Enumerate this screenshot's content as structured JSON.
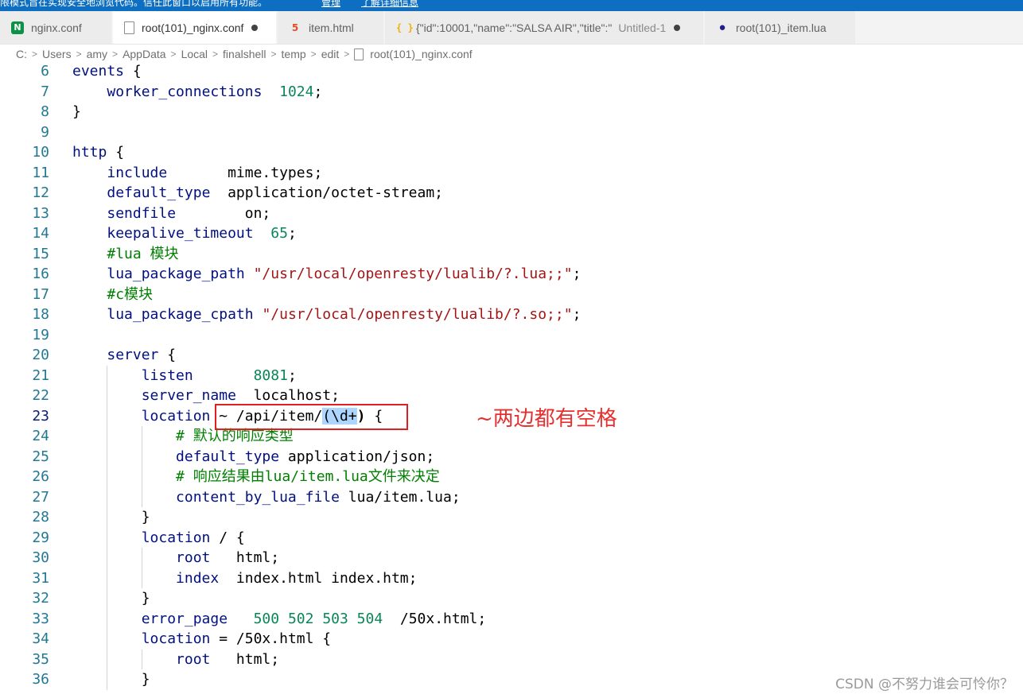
{
  "notice": {
    "message": "限模式旨在实现安全地浏览代码。信任此窗口以启用所有功能。",
    "manage_link": "管理",
    "learn_link": "了解详细信息"
  },
  "tabs": [
    {
      "label": "nginx.conf",
      "icon": "nginx-icon",
      "active": false,
      "modified": false
    },
    {
      "label": "root(101)_nginx.conf",
      "icon": "file-icon",
      "active": true,
      "modified": true
    },
    {
      "label": "item.html",
      "icon": "html5-icon",
      "active": false,
      "modified": false
    },
    {
      "label": "{\"id\":10001,\"name\":\"SALSA AIR\",\"title\":\"",
      "extra": "Untitled-1",
      "icon": "json-braces-icon",
      "active": false,
      "modified": true
    },
    {
      "label": "root(101)_item.lua",
      "icon": "lua-icon",
      "active": false,
      "modified": false
    }
  ],
  "breadcrumb": [
    "C:",
    "Users",
    "amy",
    "AppData",
    "Local",
    "finalshell",
    "temp",
    "edit",
    "root(101)_nginx.conf"
  ],
  "lines": [
    {
      "n": "6",
      "t": "events {"
    },
    {
      "n": "7",
      "t": "    worker_connections  1024;"
    },
    {
      "n": "8",
      "t": "}"
    },
    {
      "n": "9",
      "t": ""
    },
    {
      "n": "10",
      "t": "http {"
    },
    {
      "n": "11",
      "t": "    include       mime.types;"
    },
    {
      "n": "12",
      "t": "    default_type  application/octet-stream;"
    },
    {
      "n": "13",
      "t": "    sendfile        on;"
    },
    {
      "n": "14",
      "t": "    keepalive_timeout  65;"
    },
    {
      "n": "15",
      "t": "    #lua 模块"
    },
    {
      "n": "16",
      "t": "    lua_package_path \"/usr/local/openresty/lualib/?.lua;;\";"
    },
    {
      "n": "17",
      "t": "    #c模块"
    },
    {
      "n": "18",
      "t": "    lua_package_cpath \"/usr/local/openresty/lualib/?.so;;\";"
    },
    {
      "n": "19",
      "t": ""
    },
    {
      "n": "20",
      "t": "    server {"
    },
    {
      "n": "21",
      "t": "        listen       8081;"
    },
    {
      "n": "22",
      "t": "        server_name  localhost;"
    },
    {
      "n": "23",
      "t": "        location ~ /api/item/(\\d+) {"
    },
    {
      "n": "24",
      "t": "            # 默认的响应类型"
    },
    {
      "n": "25",
      "t": "            default_type application/json;"
    },
    {
      "n": "26",
      "t": "            # 响应结果由lua/item.lua文件来决定"
    },
    {
      "n": "27",
      "t": "            content_by_lua_file lua/item.lua;"
    },
    {
      "n": "28",
      "t": "        }"
    },
    {
      "n": "29",
      "t": "        location / {"
    },
    {
      "n": "30",
      "t": "            root   html;"
    },
    {
      "n": "31",
      "t": "            index  index.html index.htm;"
    },
    {
      "n": "32",
      "t": "        }"
    },
    {
      "n": "33",
      "t": "        error_page   500 502 503 504  /50x.html;"
    },
    {
      "n": "34",
      "t": "        location = /50x.html {"
    },
    {
      "n": "35",
      "t": "            root   html;"
    },
    {
      "n": "36",
      "t": "        }"
    }
  ],
  "annotation": "~两边都有空格",
  "watermark": "CSDN @不努力谁会可怜你？",
  "colors": {
    "accent_bar": "#0e6fc2",
    "annotation": "#e53030",
    "keyword": "#001080",
    "comment": "#008000",
    "number": "#098658"
  }
}
